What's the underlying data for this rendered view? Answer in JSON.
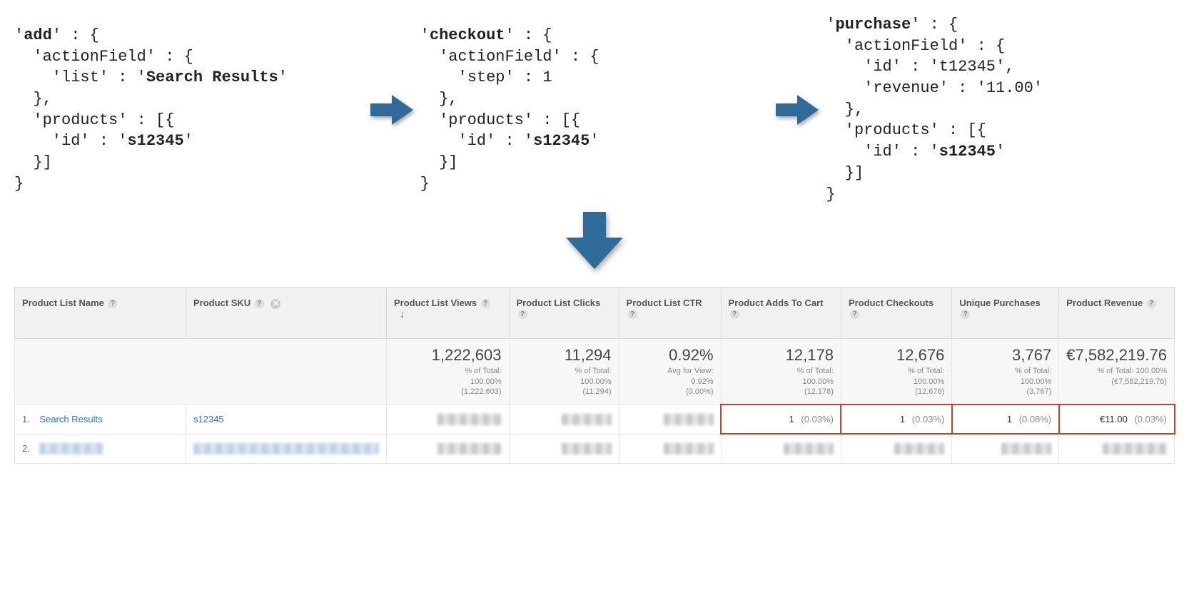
{
  "code": {
    "add": {
      "key": "add",
      "actionFieldKey": "actionField",
      "listKey": "list",
      "listVal": "Search Results",
      "productsKey": "products",
      "idKey": "id",
      "idVal": "s12345"
    },
    "checkout": {
      "key": "checkout",
      "actionFieldKey": "actionField",
      "stepKey": "step",
      "stepVal": "1",
      "productsKey": "products",
      "idKey": "id",
      "idVal": "s12345"
    },
    "purchase": {
      "key": "purchase",
      "actionFieldKey": "actionField",
      "idKey": "id",
      "idVal": "t12345",
      "revenueKey": "revenue",
      "revenueVal": "11.00",
      "productsKey": "products",
      "prodIdKey": "id",
      "prodIdVal": "s12345"
    }
  },
  "table": {
    "headers": {
      "name": "Product List Name",
      "sku": "Product SKU",
      "views": "Product List Views",
      "clicks": "Product List Clicks",
      "ctr": "Product List CTR",
      "adds": "Product Adds To Cart",
      "checkouts": "Product Checkouts",
      "unique": "Unique Purchases",
      "revenue": "Product Revenue"
    },
    "summary": {
      "views": {
        "big": "1,222,603",
        "sub1": "% of Total:",
        "sub2": "100.00%",
        "sub3": "(1,222,603)"
      },
      "clicks": {
        "big": "11,294",
        "sub1": "% of Total:",
        "sub2": "100.00%",
        "sub3": "(11,294)"
      },
      "ctr": {
        "big": "0.92%",
        "sub1": "Avg for View:",
        "sub2": "0.92%",
        "sub3": "(0.00%)"
      },
      "adds": {
        "big": "12,178",
        "sub1": "% of Total:",
        "sub2": "100.00%",
        "sub3": "(12,178)"
      },
      "checkouts": {
        "big": "12,676",
        "sub1": "% of Total:",
        "sub2": "100.00%",
        "sub3": "(12,676)"
      },
      "unique": {
        "big": "3,767",
        "sub1": "% of Total:",
        "sub2": "100.00%",
        "sub3": "(3,767)"
      },
      "revenue": {
        "big": "€7,582,219.76",
        "sub1": "% of Total: 100.00%",
        "sub2": "(€7,582,219.76)"
      }
    },
    "rows": [
      {
        "idx": "1.",
        "name": "Search Results",
        "sku": "s12345",
        "adds": {
          "v": "1",
          "pct": "(0.03%)"
        },
        "checkouts": {
          "v": "1",
          "pct": "(0.03%)"
        },
        "unique": {
          "v": "1",
          "pct": "(0.08%)"
        },
        "revenue": {
          "v": "€11.00",
          "pct": "(0.03%)"
        }
      },
      {
        "idx": "2."
      }
    ]
  },
  "colors": {
    "arrow": "#2e6b99",
    "highlight": "#cc3b2a",
    "link": "#1a73e8"
  }
}
